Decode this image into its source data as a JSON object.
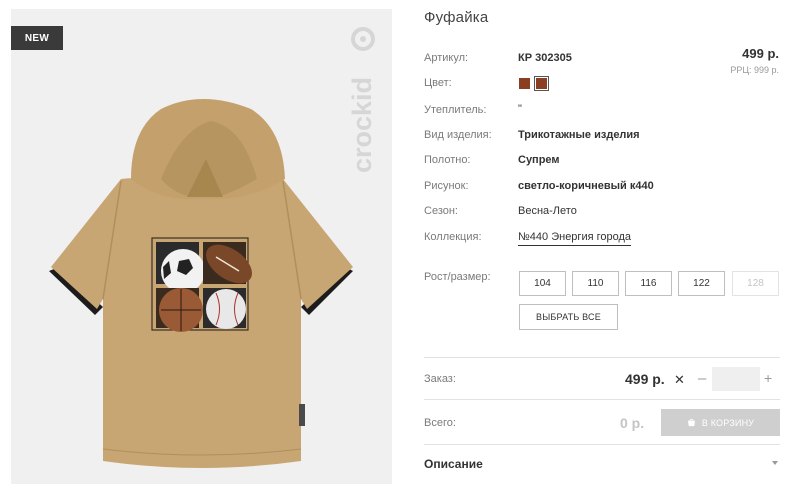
{
  "badge": "NEW",
  "brand": "crockid",
  "product": {
    "title": "Фуфайка",
    "price": "499 р.",
    "rrp": "РРЦ: 999 р."
  },
  "attributes": {
    "article_label": "Артикул:",
    "article_value": "КР 302305",
    "color_label": "Цвет:",
    "insulation_label": "Утеплитель:",
    "insulation_value": "\"",
    "type_label": "Вид изделия:",
    "type_value": "Трикотажные изделия",
    "fabric_label": "Полотно:",
    "fabric_value": "Супрем",
    "pattern_label": "Рисунок:",
    "pattern_value": "светло-коричневый к440",
    "season_label": "Сезон:",
    "season_value": "Весна-Лето",
    "collection_label": "Коллекция:",
    "collection_value": "№440 Энергия города"
  },
  "colors": {
    "swatch": "#8a3e22",
    "product": "#c8a673",
    "button_disabled": "#cfcfcf"
  },
  "sizes": {
    "label": "Рост/размер:",
    "options": [
      "104",
      "110",
      "116",
      "122",
      "128"
    ],
    "select_all": "ВЫБРАТЬ ВСЕ"
  },
  "order": {
    "label": "Заказ:",
    "price": "499 р.",
    "times": "✕",
    "minus": "–",
    "plus": "+",
    "quantity": ""
  },
  "total": {
    "label": "Всего:",
    "value": "0 р.",
    "cart_button": "В КОРЗИНУ"
  },
  "description": {
    "title": "Описание"
  }
}
